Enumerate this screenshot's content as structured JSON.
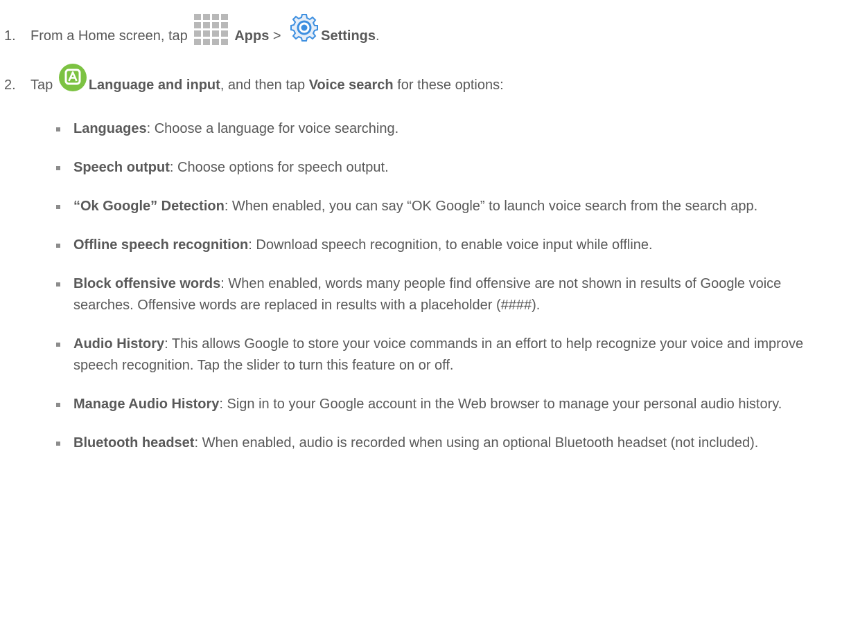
{
  "steps": [
    {
      "number": "1.",
      "text_before": "From a Home screen, tap ",
      "apps_label": "Apps",
      "sep": " > ",
      "settings_label": "Settings",
      "end": "."
    },
    {
      "number": "2.",
      "tap": "Tap ",
      "language_label": "Language and input",
      "middle": ", and then tap ",
      "voice_search_label": "Voice search",
      "end": " for these options:"
    }
  ],
  "options": [
    {
      "term": "Languages",
      "desc": ": Choose a language for voice searching."
    },
    {
      "term": "Speech output",
      "desc": ": Choose options for speech output."
    },
    {
      "term": " “Ok Google” Detection",
      "desc": ": When enabled, you can say “OK Google” to launch voice search from the search app."
    },
    {
      "term": "Offline speech recognition",
      "desc": ": Download speech recognition, to enable voice input while offline."
    },
    {
      "term": "Block offensive words",
      "desc": ": When enabled, words many people find offensive are not shown in results of Google voice searches. Offensive words are replaced in results with a placeholder (####)."
    },
    {
      "term": "Audio History",
      "desc": ": This allows Google to store your voice commands in an effort to help recognize your voice and improve speech recognition. Tap the slider to turn this feature on or off."
    },
    {
      "term": "Manage Audio History",
      "desc": ": Sign in to your Google account in the Web browser to manage your personal audio history."
    },
    {
      "term": "Bluetooth headset",
      "desc": ": When enabled, audio is recorded when using an optional Bluetooth headset (not included)."
    }
  ],
  "icons": {
    "apps": "apps-grid-icon",
    "settings": "settings-gear-icon",
    "language": "language-input-icon"
  },
  "colors": {
    "text": "#595959",
    "apps_grid": "#b8b8b8",
    "gear": "#3d8fe0",
    "language_green": "#7cc242",
    "bullet": "#8c8c8c"
  }
}
